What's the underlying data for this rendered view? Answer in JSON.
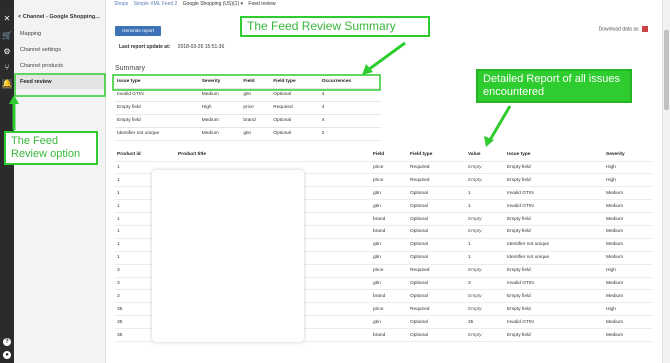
{
  "rail": {
    "icons": [
      "close-icon",
      "cart-icon",
      "gear-icon",
      "merge-icon",
      "bell-icon",
      "help-icon",
      "user-icon"
    ]
  },
  "sidebar": {
    "title": "Channel - Google Shopping...",
    "back": "<",
    "items": [
      {
        "label": "Mapping"
      },
      {
        "label": "Channel settings"
      },
      {
        "label": "Channel products"
      },
      {
        "label": "Feed review"
      }
    ]
  },
  "breadcrumb": [
    "Shops",
    "Simple XML Feed 2",
    "Google Shopping (US)(1) ▾",
    "Feed review"
  ],
  "toolbar": {
    "generate_label": "Generate report",
    "download_label": "Download data as"
  },
  "last_update": {
    "label": "Last report update at:",
    "value": "2018-03-26 15:51:36"
  },
  "summary": {
    "title": "Summary",
    "columns": [
      "Issue type",
      "Severity",
      "Field",
      "Field type",
      "Occurrences"
    ],
    "rows": [
      [
        "Invalid GTIN",
        "Medium",
        "gtin",
        "Optional",
        "4"
      ],
      [
        "Empty field",
        "High",
        "price",
        "Required",
        "4"
      ],
      [
        "Empty field",
        "Medium",
        "brand",
        "Optional",
        "4"
      ],
      [
        "Identifier not unique",
        "Medium",
        "gtin",
        "Optional",
        "2"
      ]
    ]
  },
  "details": {
    "columns": [
      "Product id",
      "Product title",
      "Field",
      "Field type",
      "Value",
      "Issue type",
      "Severity"
    ],
    "rows": [
      [
        "1",
        "",
        "price",
        "Required",
        "Empty",
        "Empty field",
        "High"
      ],
      [
        "1",
        "",
        "price",
        "Required",
        "Empty",
        "Empty field",
        "High"
      ],
      [
        "1",
        "",
        "gtin",
        "Optional",
        "1",
        "Invalid GTIN",
        "Medium"
      ],
      [
        "1",
        "",
        "gtin",
        "Optional",
        "1",
        "Invalid GTIN",
        "Medium"
      ],
      [
        "1",
        "",
        "brand",
        "Optional",
        "Empty",
        "Empty field",
        "Medium"
      ],
      [
        "1",
        "",
        "brand",
        "Optional",
        "Empty",
        "Empty field",
        "Medium"
      ],
      [
        "1",
        "",
        "gtin",
        "Optional",
        "1",
        "Identifier not unique",
        "Medium"
      ],
      [
        "1",
        "",
        "gtin",
        "Optional",
        "1",
        "Identifier not unique",
        "Medium"
      ],
      [
        "3",
        "",
        "price",
        "Required",
        "Empty",
        "Empty field",
        "High"
      ],
      [
        "3",
        "",
        "gtin",
        "Optional",
        "3",
        "Invalid GTIN",
        "Medium"
      ],
      [
        "3",
        "",
        "brand",
        "Optional",
        "Empty",
        "Empty field",
        "Medium"
      ],
      [
        "35",
        "",
        "price",
        "Required",
        "Empty",
        "Empty field",
        "High"
      ],
      [
        "35",
        "",
        "gtin",
        "Optional",
        "35",
        "Invalid GTIN",
        "Medium"
      ],
      [
        "35",
        "",
        "brand",
        "Optional",
        "Empty",
        "Empty field",
        "Medium"
      ]
    ]
  },
  "annotations": {
    "summary_callout": "The Feed Review Summary",
    "details_callout": "Detailed Report of all issues encountered",
    "option_callout": "The Feed Review option"
  },
  "colors": {
    "accent": "#3d73b6",
    "annotation": "#2ecc2e",
    "rail": "#2b2b2b"
  }
}
